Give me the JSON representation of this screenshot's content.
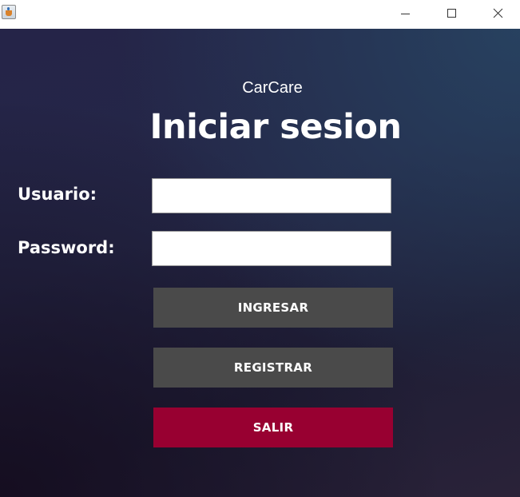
{
  "window": {
    "controls": {
      "minimize_icon": "minimize-icon",
      "maximize_icon": "maximize-icon",
      "close_icon": "close-icon"
    },
    "app_icon": "java-coffee-icon"
  },
  "login": {
    "brand": "CarCare",
    "title": "Iniciar sesion",
    "username_label": "Usuario:",
    "username_value": "",
    "password_label": "Password:",
    "password_value": "",
    "buttons": {
      "login": "INGRESAR",
      "register": "REGISTRAR",
      "exit": "SALIR"
    }
  },
  "colors": {
    "background_dark": "#242747",
    "button_gray": "#4a4a4a",
    "button_red": "#980031",
    "text": "#ffffff"
  }
}
